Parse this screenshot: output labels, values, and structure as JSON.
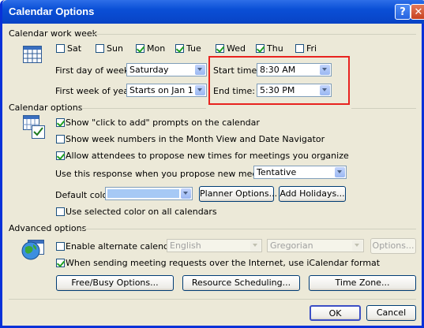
{
  "window": {
    "title": "Calendar Options"
  },
  "work_week": {
    "header": "Calendar work week",
    "days": [
      {
        "label": "Sat",
        "checked": false
      },
      {
        "label": "Sun",
        "checked": false
      },
      {
        "label": "Mon",
        "checked": true
      },
      {
        "label": "Tue",
        "checked": true
      },
      {
        "label": "Wed",
        "checked": true
      },
      {
        "label": "Thu",
        "checked": true
      },
      {
        "label": "Fri",
        "checked": false
      }
    ],
    "first_day_label": "First day of week:",
    "first_day_value": "Saturday",
    "first_week_label": "First week of year:",
    "first_week_value": "Starts on Jan 1",
    "start_label": "Start time:",
    "start_value": "8:30 AM",
    "end_label": "End time:",
    "end_value": "5:30 PM"
  },
  "calendar_options": {
    "header": "Calendar options",
    "click_to_add": "Show \"click to add\" prompts on the calendar",
    "week_numbers": "Show week numbers in the Month View and Date Navigator",
    "allow_propose": "Allow attendees to propose new times for meetings you organize",
    "response_label": "Use this response when you propose new meeting times:",
    "response_value": "Tentative",
    "default_color_label": "Default color:",
    "planner_button": "Planner Options...",
    "holidays_button": "Add Holidays...",
    "use_color": "Use selected color on all calendars"
  },
  "advanced": {
    "header": "Advanced options",
    "alt_calendar": "Enable alternate calendar:",
    "alt_lang": "English",
    "alt_type": "Gregorian",
    "options_button": "Options...",
    "icalendar": "When sending meeting requests over the Internet, use iCalendar format",
    "freebusy_button": "Free/Busy Options...",
    "resource_button": "Resource Scheduling...",
    "timezone_button": "Time Zone..."
  },
  "footer": {
    "ok": "OK",
    "cancel": "Cancel"
  },
  "colors": {
    "accent": "#0a4fd6",
    "highlight": "#e8231f",
    "default_color_swatch": "#a6c9f5"
  }
}
